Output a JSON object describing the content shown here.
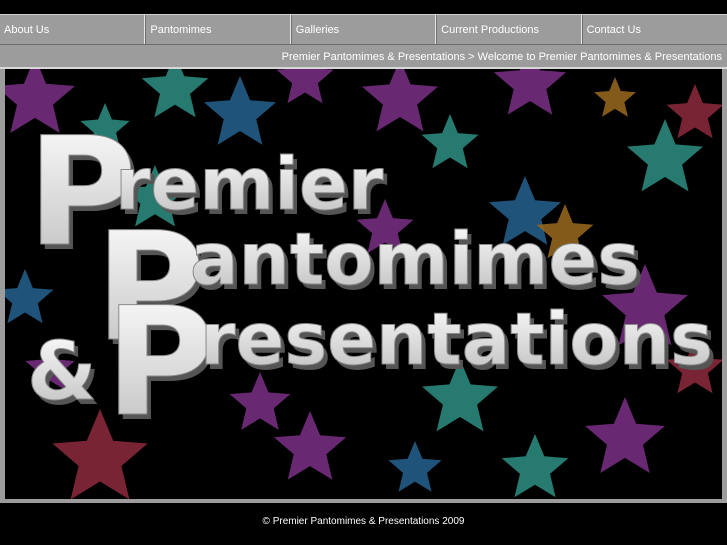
{
  "nav": {
    "items": [
      {
        "label": "About Us"
      },
      {
        "label": "Pantomimes"
      },
      {
        "label": "Galleries"
      },
      {
        "label": "Current Productions"
      },
      {
        "label": "Contact Us"
      }
    ]
  },
  "breadcrumb": {
    "root": "Premier Pantomimes & Presentations",
    "separator": ">",
    "current": "Welcome to Premier Pantomimes & Presentations"
  },
  "banner": {
    "logo_line1_initial": "P",
    "logo_line1_rest": "remier",
    "logo_line2_initial": "P",
    "logo_line2_rest": "antomimes",
    "logo_ampersand": "&",
    "logo_line3_initial": "P",
    "logo_line3_rest": "resentations"
  },
  "footer": {
    "copyright": "© Premier Pantomimes & Presentations 2009"
  },
  "colors": {
    "nav_bg": "#9c9c9c",
    "page_bg": "#000000",
    "star_colors": [
      "#7a2f86",
      "#2d8f82",
      "#8e2a3d",
      "#9b6a1e",
      "#25628f"
    ]
  }
}
